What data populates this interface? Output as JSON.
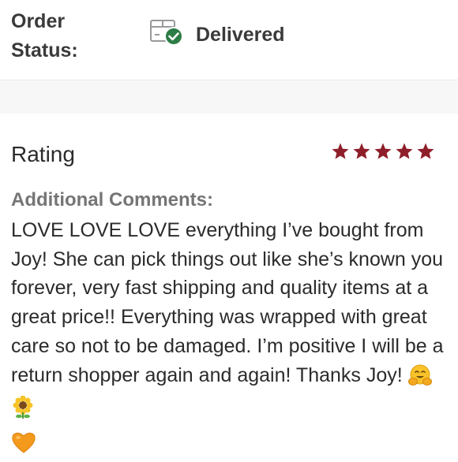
{
  "order_status": {
    "label": "Order Status:",
    "value": "Delivered",
    "icon": "package-delivered-icon",
    "check_color": "#2e7d46"
  },
  "rating": {
    "label": "Rating",
    "stars": 5,
    "max_stars": 5,
    "star_color": "#8e1f2a"
  },
  "comments": {
    "heading": "Additional Comments:",
    "text": "LOVE LOVE LOVE everything I’ve bought from Joy! She can pick things out like she’s known you forever, very fast shipping and quality items at a great price!! Everything was wrapped with great care so not to be damaged. I’m positive I will be a return shopper again and again! Thanks Joy!",
    "emojis": [
      "hugging-face-icon",
      "sunflower-icon",
      "orange-heart-icon"
    ]
  }
}
